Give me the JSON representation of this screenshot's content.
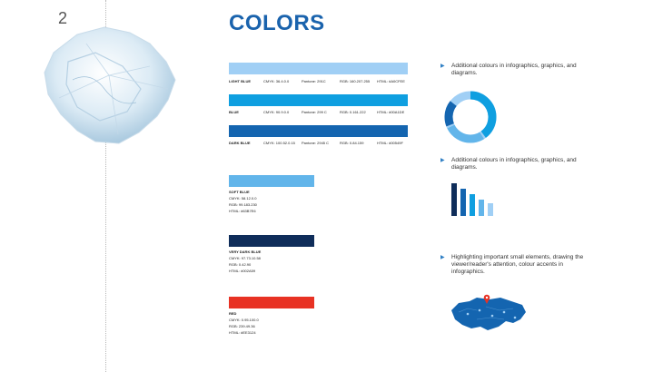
{
  "page_number": "2",
  "title": "COLORS",
  "colors": {
    "light_blue": "#a0cff5",
    "blue": "#0f9fe0",
    "dark_blue": "#1465b0",
    "soft_blue": "#62b5ea",
    "very_dark_blue": "#0f2d5a",
    "red": "#e83224"
  },
  "color_bars": [
    {
      "name": "LIGHT BLUE",
      "cmyk": "CMYK: 36.4.0.0",
      "pantone": "Pantone: 291C",
      "rgb": "RGB: 160.207.255",
      "html": "HTML: #A0CFEE"
    },
    {
      "name": "BLUE",
      "cmyk": "CMYK: 90.9.0.0",
      "pantone": "Pantone: 299 C",
      "rgb": "RGB: 0.161.222",
      "html": "HTML: #00A1DE"
    },
    {
      "name": "DARK BLUE",
      "cmyk": "CMYK: 100.52.0.15",
      "pantone": "Pantone: 2945 C",
      "rgb": "RGB: 0.84.159",
      "html": "HTML: #00549F"
    }
  ],
  "swatches": [
    {
      "name": "SOFT BLUE",
      "cmyk": "CMYK: 58.12.0.0",
      "rgb": "RGB: 99.183.230",
      "html": "HTML: #63B7E6"
    },
    {
      "name": "VERY DARK BLUE",
      "cmyk": "CMYK: 97.73.10.58",
      "rgb": "RGB: 0.42.90",
      "html": "HTML: #002A59"
    },
    {
      "name": "RED",
      "cmyk": "CMYK: 0.95.100.0",
      "rgb": "RGB: 239.49.36",
      "html": "HTML: #EE3124"
    }
  ],
  "bullets": [
    "Additional colours in infographics, graphics, and diagrams.",
    "Additional colours in infographics, graphics, and diagrams.",
    "Highlighting important small elements, drawing the viewer/reader's attention, colour accents in infographics."
  ],
  "bullet_icon": "triangle-right-icon",
  "illustration_icons": [
    "ice-crystal-icon",
    "donut-chart-icon",
    "bar-chart-icon",
    "world-map-icon",
    "map-pin-icon"
  ]
}
